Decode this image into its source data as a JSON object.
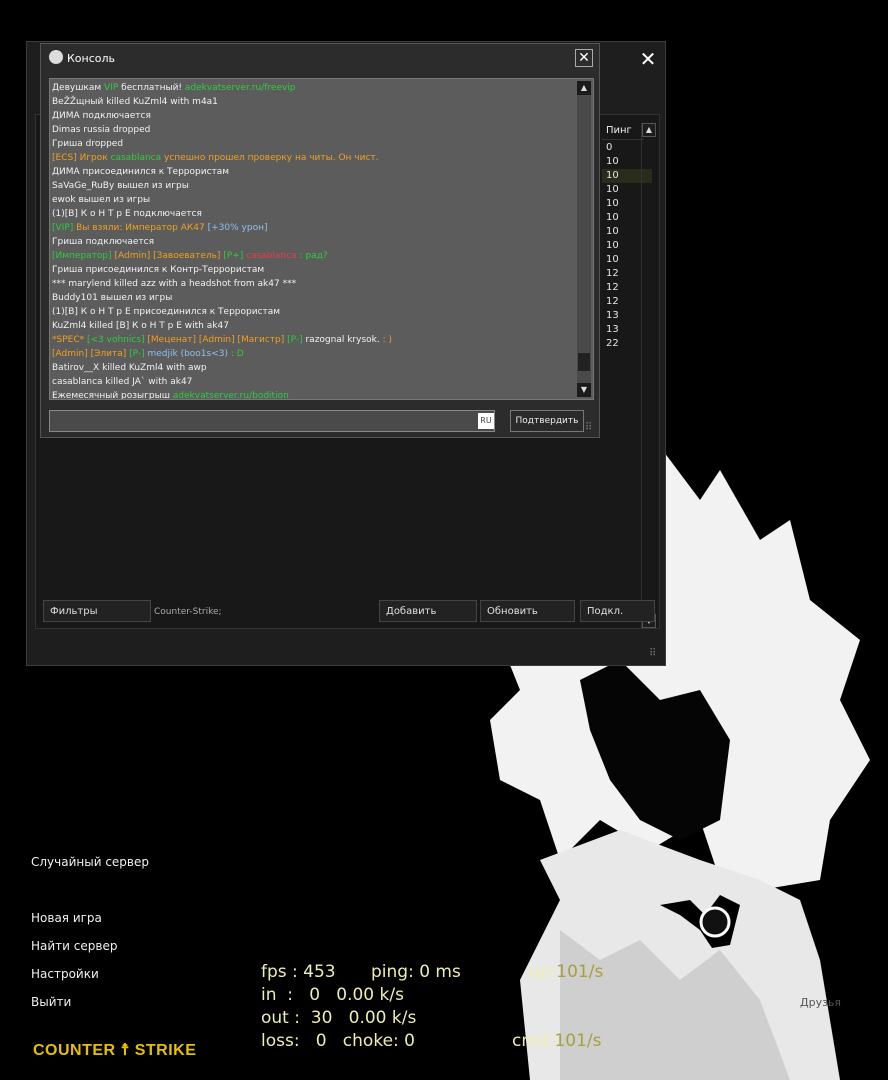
{
  "console": {
    "title": "Консоль",
    "close": "✕",
    "lines": [
      [
        {
          "t": "Девушкам ",
          "c": "w"
        },
        {
          "t": "VIP",
          "c": "g"
        },
        {
          "t": " бесплатный! ",
          "c": "w"
        },
        {
          "t": "adekvatserver.ru/freevip",
          "c": "g"
        }
      ],
      [
        {
          "t": "BeŽŽщный killed KuZml4 with m4a1",
          "c": "w"
        }
      ],
      [
        {
          "t": "ДИМА подключается",
          "c": "w"
        }
      ],
      [
        {
          "t": "Dimas russia dropped",
          "c": "w"
        }
      ],
      [
        {
          "t": "Гриша dropped",
          "c": "w"
        }
      ],
      [
        {
          "t": "[ECS] ",
          "c": "o"
        },
        {
          "t": "Игрок ",
          "c": "o"
        },
        {
          "t": "casablanca",
          "c": "g"
        },
        {
          "t": " успешно прошел проверку на читы. Он чист.",
          "c": "o"
        }
      ],
      [
        {
          "t": "ДИМА присоединился к Террористам",
          "c": "w"
        }
      ],
      [
        {
          "t": "SaVaGe_RuBy вышел из игры",
          "c": "w"
        }
      ],
      [
        {
          "t": "ewok вышел из игры",
          "c": "w"
        }
      ],
      [
        {
          "t": "(1)[B] К о Н Т р Е подключается",
          "c": "w"
        }
      ],
      [
        {
          "t": "[VIP] ",
          "c": "g"
        },
        {
          "t": "Вы взяли: Император АК47 ",
          "c": "o"
        },
        {
          "t": "[+30% урон]",
          "c": "b"
        }
      ],
      [
        {
          "t": "Гриша подключается",
          "c": "w"
        }
      ],
      [
        {
          "t": "[Император] ",
          "c": "g"
        },
        {
          "t": "[Admin] ",
          "c": "o"
        },
        {
          "t": "[Завоеватель] ",
          "c": "o"
        },
        {
          "t": "[P+] ",
          "c": "g"
        },
        {
          "t": "casablanca",
          "c": "r"
        },
        {
          "t": " : рад?",
          "c": "g"
        }
      ],
      [
        {
          "t": "Гриша присоединился к Контр-Террористам",
          "c": "w"
        }
      ],
      [
        {
          "t": "*** marylend killed azz with a headshot from ak47 ***",
          "c": "w"
        }
      ],
      [
        {
          "t": "Buddy101 вышел из игры",
          "c": "w"
        }
      ],
      [
        {
          "t": "(1)[B] К о Н Т р Е присоединился к Террористам",
          "c": "w"
        }
      ],
      [
        {
          "t": "KuZml4 killed [B] К о Н Т р Е with ak47",
          "c": "w"
        }
      ],
      [
        {
          "t": "*SPEC* ",
          "c": "o"
        },
        {
          "t": "[<3 vohnics] ",
          "c": "g"
        },
        {
          "t": "[Меценат] ",
          "c": "o"
        },
        {
          "t": "[Admin] ",
          "c": "o"
        },
        {
          "t": "[Магистр] ",
          "c": "o"
        },
        {
          "t": "[P-] ",
          "c": "g"
        },
        {
          "t": "razognal krysok. ",
          "c": "w"
        },
        {
          "t": ": )",
          "c": "o"
        }
      ],
      [
        {
          "t": "[Admin] ",
          "c": "o"
        },
        {
          "t": "[Элита] ",
          "c": "o"
        },
        {
          "t": "[P-] ",
          "c": "g"
        },
        {
          "t": "medjik (boo1s<3)",
          "c": "b"
        },
        {
          "t": " : D",
          "c": "g"
        }
      ],
      [
        {
          "t": "Batirov__X killed KuZml4 with awp",
          "c": "w"
        }
      ],
      [
        {
          "t": "casablanca killed JA` with ak47",
          "c": "w"
        }
      ],
      [
        {
          "t": "Ежемесячный розыгрыш ",
          "c": "w"
        },
        {
          "t": "adekvatserver.ru/bodition",
          "c": "g"
        }
      ]
    ],
    "input_value": "",
    "lang": "RU",
    "submit_label": "Подтвердить"
  },
  "browser": {
    "close": "✕",
    "ping_header": "Пинг",
    "pings": [
      "0",
      "10",
      "10",
      "10",
      "10",
      "10",
      "10",
      "10",
      "10",
      "12",
      "12",
      "12",
      "13",
      "13",
      "22"
    ],
    "filters_label": "Фильтры",
    "filter_text": "Counter-Strike;",
    "add_label": "Добавить",
    "refresh_label": "Обновить",
    "connect_label": "Подкл."
  },
  "menu": {
    "random_server": "Случайный сервер",
    "new_game": "Новая игра",
    "find_server": "Найти сервер",
    "settings": "Настройки",
    "exit": "Выйти",
    "logo_part1": "Counter",
    "logo_part2": "Strike",
    "friends": "Друзья"
  },
  "netgraph": {
    "fps": "fps : 453",
    "ping": "ping: 0 ms",
    "up_label": "up:",
    "up_value": "101/s",
    "in": "in  :   0   0.00 k/s",
    "out": "out :  30   0.00 k/s",
    "loss": "loss:   0   choke: 0",
    "cmd_label": "cmd:",
    "cmd_value": "101/s"
  }
}
